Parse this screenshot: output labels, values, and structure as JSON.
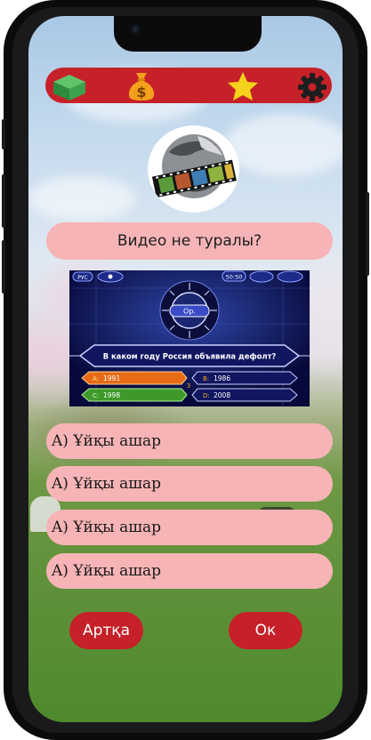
{
  "topbar": {
    "icons": [
      "cube-icon",
      "money-bag-icon",
      "star-icon",
      "gear-icon"
    ],
    "color": "#c62129"
  },
  "question": {
    "text": "Видео не туралы?"
  },
  "video": {
    "corner_left": "РУС",
    "timer": "50:50",
    "center_label": "Ор.",
    "question_text": "В каком году Россия объявила дефолт?",
    "options": [
      {
        "letter": "A:",
        "text": "1991"
      },
      {
        "letter": "B:",
        "text": "1986"
      },
      {
        "letter": "C:",
        "text": "1998"
      },
      {
        "letter": "D:",
        "text": "2008"
      }
    ],
    "middle_marker": "3"
  },
  "answers": [
    {
      "label": "A) Ұйқы ашар"
    },
    {
      "label": "A) Ұйқы ашар"
    },
    {
      "label": "A) Ұйқы ашар"
    },
    {
      "label": "A) Ұйқы ашар"
    }
  ],
  "buttons": {
    "back": "Артқа",
    "ok": "Ок"
  },
  "colors": {
    "accent": "#c62129",
    "pill": "#f7b4b6"
  }
}
